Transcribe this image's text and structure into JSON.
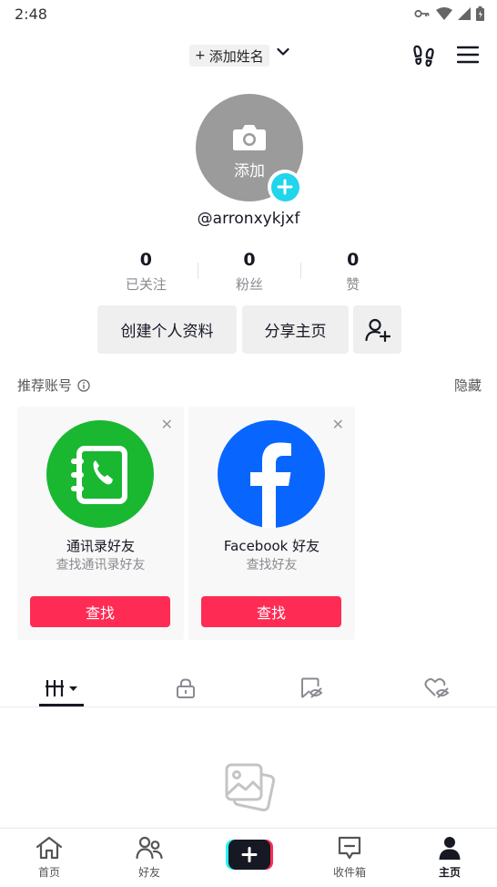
{
  "status_bar": {
    "time": "2:48"
  },
  "top_bar": {
    "add_name_plus": "+",
    "add_name_label": "添加姓名"
  },
  "profile": {
    "avatar_label": "添加",
    "username": "@arronxykjxf",
    "stats": [
      {
        "count": "0",
        "label": "已关注"
      },
      {
        "count": "0",
        "label": "粉丝"
      },
      {
        "count": "0",
        "label": "赞"
      }
    ],
    "edit_button": "创建个人资料",
    "share_button": "分享主页"
  },
  "recommend": {
    "header": "推荐账号",
    "hide": "隐藏",
    "cards": [
      {
        "title": "通讯录好友",
        "subtitle": "查找通讯录好友",
        "button": "查找",
        "color": "#1ab731"
      },
      {
        "title": "Facebook 好友",
        "subtitle": "查找好友",
        "button": "查找",
        "color": "#0866ff"
      }
    ]
  },
  "bottom_nav": {
    "home": "首页",
    "friends": "好友",
    "inbox": "收件箱",
    "profile": "主页"
  },
  "colors": {
    "accent": "#fe2c55",
    "teal": "#20d5ec"
  }
}
